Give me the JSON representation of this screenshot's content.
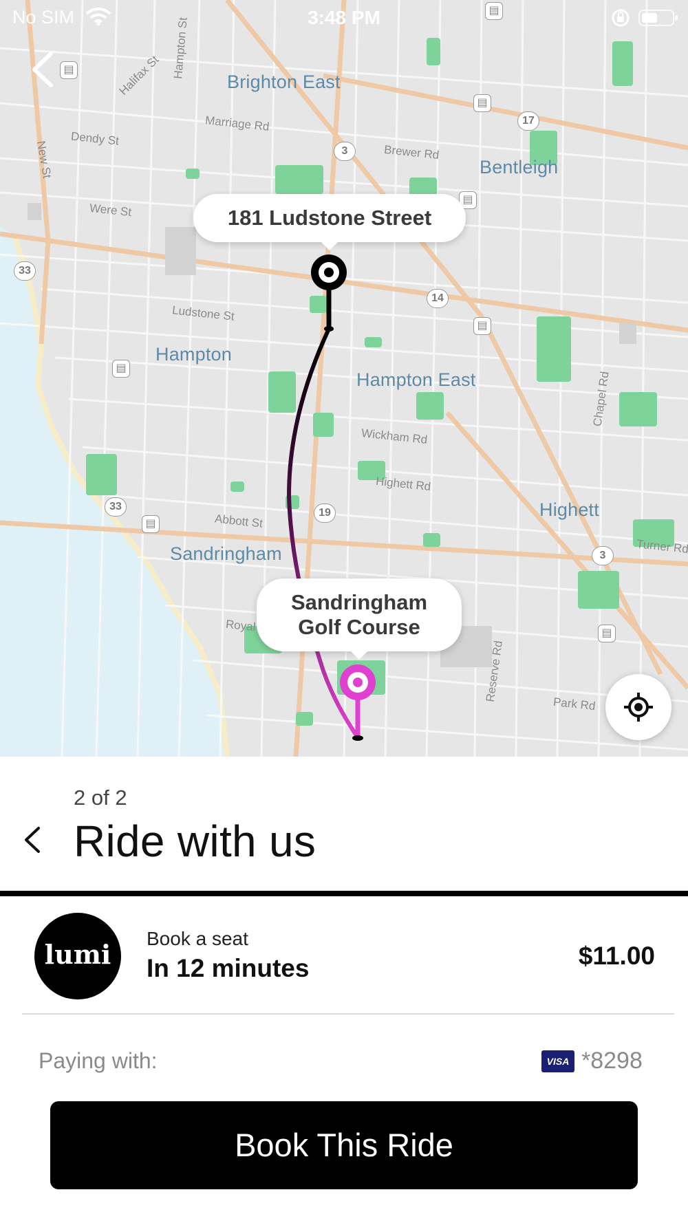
{
  "status_bar": {
    "carrier": "No SIM",
    "time": "3:48 PM"
  },
  "map": {
    "places": [
      {
        "name": "Brighton East"
      },
      {
        "name": "Bentleigh"
      },
      {
        "name": "Hampton"
      },
      {
        "name": "Hampton East"
      },
      {
        "name": "Highett"
      },
      {
        "name": "Sandringham"
      }
    ],
    "streets": [
      "New St",
      "Dendy St",
      "Were St",
      "Marriage Rd",
      "Brewer Rd",
      "Ludstone St",
      "Wickham Rd",
      "Highett Rd",
      "Abbott St",
      "Park Rd",
      "Reserve Rd",
      "Chapel Rd",
      "Halifax St",
      "Hampton St",
      "Royal",
      "Turner Rd"
    ],
    "route_shields": [
      "33",
      "3",
      "17",
      "14",
      "19",
      "33",
      "3"
    ],
    "origin_label": "181 Ludstone Street",
    "destination_line1": "Sandringham",
    "destination_line2": "Golf Course",
    "route_colors": {
      "start": "#000000",
      "end": "#e040d0"
    }
  },
  "sheet": {
    "step": "2 of 2",
    "title": "Ride with us"
  },
  "ride_option": {
    "logo_text": "lumi",
    "subtitle": "Book a seat",
    "eta": "In 12 minutes",
    "price": "$11.00"
  },
  "payment": {
    "label": "Paying with:",
    "card_brand": "VISA",
    "card_number": "*8298"
  },
  "book_button": "Book This Ride"
}
